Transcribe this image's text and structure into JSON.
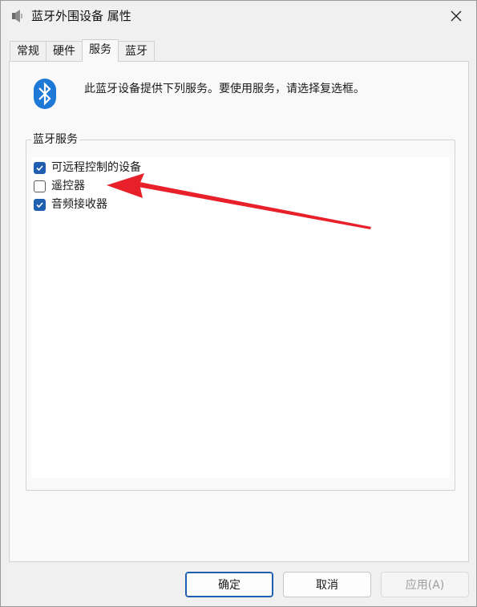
{
  "window": {
    "title": "蓝牙外围设备 属性",
    "icon": "speaker-icon"
  },
  "tabs": [
    {
      "label": "常规",
      "active": false
    },
    {
      "label": "硬件",
      "active": false
    },
    {
      "label": "服务",
      "active": true
    },
    {
      "label": "蓝牙",
      "active": false
    }
  ],
  "panel": {
    "icon": "bluetooth-icon",
    "intro": "此蓝牙设备提供下列服务。要使用服务，请选择复选框。",
    "group_label": "蓝牙服务",
    "services": [
      {
        "label": "可远程控制的设备",
        "checked": true
      },
      {
        "label": "遥控器",
        "checked": false
      },
      {
        "label": "音频接收器",
        "checked": true
      }
    ]
  },
  "buttons": {
    "ok": "确定",
    "cancel": "取消",
    "apply": "应用(A)"
  },
  "colors": {
    "accent": "#1f5fb0",
    "bluetooth": "#1e78d6",
    "annotation_arrow": "#e8202a"
  }
}
